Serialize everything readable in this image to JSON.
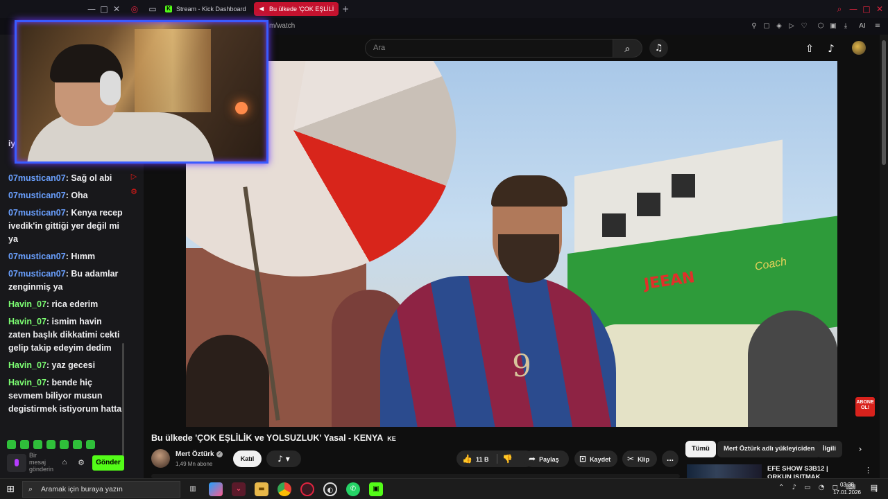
{
  "browser": {
    "tabs": [
      {
        "label": "Stream - Kick Dashboard",
        "active": false
      },
      {
        "label": "Bu ülkede 'ÇOK EŞLİLİ",
        "active": true
      }
    ],
    "new_tab_label": "+",
    "url_fragment": "m/watch",
    "ai_label": "AI"
  },
  "chat": {
    "messages": [
      {
        "user": "07mustican07",
        "text": "Sağ ol abi",
        "color": "#6aa0ff"
      },
      {
        "user": "07mustican07",
        "text": "Oha",
        "color": "#6aa0ff"
      },
      {
        "user": "07mustican07",
        "text": "Kenya recep ivedik'in gittiği yer değil mi ya",
        "color": "#6aa0ff"
      },
      {
        "user": "07mustican07",
        "text": "Hımm",
        "color": "#6aa0ff"
      },
      {
        "user": "07mustican07",
        "text": "Bu adamlar zenginmiş ya",
        "color": "#6aa0ff"
      },
      {
        "user": "Havin_07",
        "text": "rica ederim",
        "color": "#7dff73"
      },
      {
        "user": "Havin_07",
        "text": "ismim havin zaten başlık dikkatimi cekti gelip takip edeyim dedim",
        "color": "#7dff73"
      },
      {
        "user": "Havin_07",
        "text": "yaz gecesi",
        "color": "#7dff73"
      },
      {
        "user": "Havin_07",
        "text": "bende hiç sevmem biliyor musun degistirmek istiyorum hatta",
        "color": "#7dff73"
      }
    ],
    "input_placeholder": "Bir mesaj gönderin",
    "send_label": "Gönder",
    "partial_text": "iy"
  },
  "youtube": {
    "search_placeholder": "Ara",
    "video_title": "Bu ülkede 'ÇOK EŞLİLİK ve YOLSUZLUK' Yasal - KENYA",
    "video_title_suffix": "KE",
    "video_overlay_text": "JEEAN",
    "video_overlay_text2": "Coach",
    "jersey_number": "9",
    "channel": {
      "name": "Mert Öztürk",
      "subscribers": "1,49 Mn abone",
      "join_label": "Katıl"
    },
    "actions": {
      "likes": "11 B",
      "share": "Paylaş",
      "save": "Kaydet",
      "clip": "Klip",
      "more": "..."
    },
    "chips": [
      "Tümü",
      "Mert Öztürk adlı yükleyiciden",
      "İlgili"
    ],
    "recommended": {
      "title": "EFE SHOW S3B12 | ORKUN IŞITMAK"
    },
    "abone_badge": "ABONE OL!"
  },
  "taskbar": {
    "search_placeholder": "Aramak için buraya yazın",
    "time": "03:38",
    "date": "17.01.2026",
    "notification_count": "4"
  },
  "colors": {
    "kick_green": "#53fc18",
    "youtube_red": "#c4122e",
    "webcam_border": "#3a5bff"
  }
}
